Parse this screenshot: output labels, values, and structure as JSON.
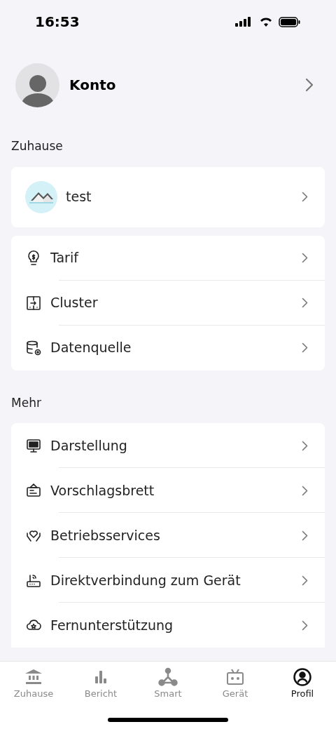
{
  "status_bar": {
    "time": "16:53"
  },
  "account": {
    "label": "Konto"
  },
  "home_section": {
    "title": "Zuhause",
    "home": {
      "name": "test"
    },
    "items": [
      {
        "kind": "tariff",
        "label": "Tarif"
      },
      {
        "kind": "cluster",
        "label": "Cluster"
      },
      {
        "kind": "datasource",
        "label": "Datenquelle"
      }
    ]
  },
  "more_section": {
    "title": "Mehr",
    "items": [
      {
        "kind": "display",
        "label": "Darstellung"
      },
      {
        "kind": "board",
        "label": "Vorschlagsbrett"
      },
      {
        "kind": "service",
        "label": "Betriebsservices"
      },
      {
        "kind": "router",
        "label": "Direktverbindung zum Gerät"
      },
      {
        "kind": "remote",
        "label": "Fernunterstützung"
      }
    ]
  },
  "tab_bar": [
    {
      "kind": "home",
      "label": "Zuhause",
      "selected": false
    },
    {
      "kind": "report",
      "label": "Bericht",
      "selected": false
    },
    {
      "kind": "smart",
      "label": "Smart",
      "selected": false
    },
    {
      "kind": "device",
      "label": "Gerät",
      "selected": false
    },
    {
      "kind": "profile",
      "label": "Profil",
      "selected": true
    }
  ]
}
